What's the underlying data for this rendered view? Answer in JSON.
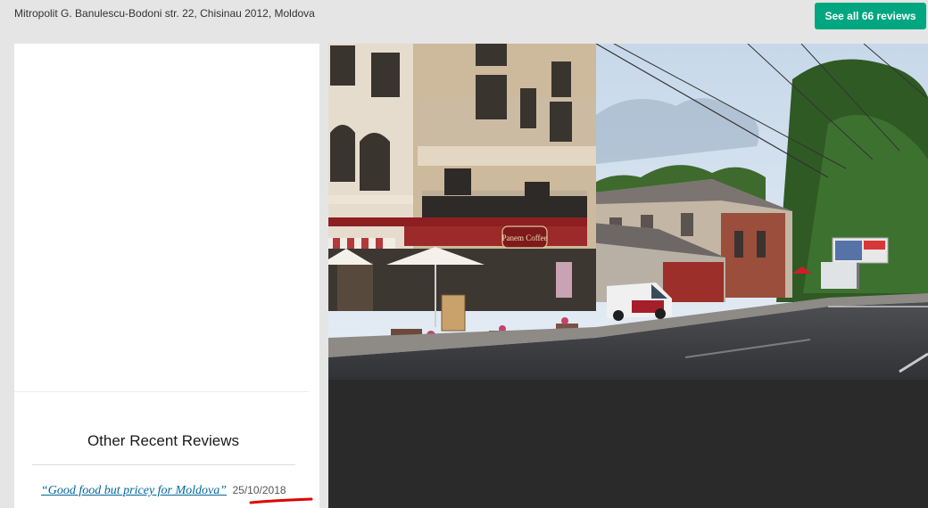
{
  "header": {
    "address": "Mitropolit G. Banulescu-Bodoni str. 22, Chisinau 2012, Moldova",
    "see_all_label": "See all 66 reviews"
  },
  "sidebar": {
    "other_reviews_title": "Other Recent Reviews",
    "reviews": [
      {
        "title": "“Good food but pricey for Moldova”",
        "date": "25/10/2018"
      }
    ]
  },
  "photo": {
    "sign_text": "Panem Coffee"
  },
  "colors": {
    "accent": "#00a680",
    "link": "#006699",
    "annotation": "#e00000"
  }
}
